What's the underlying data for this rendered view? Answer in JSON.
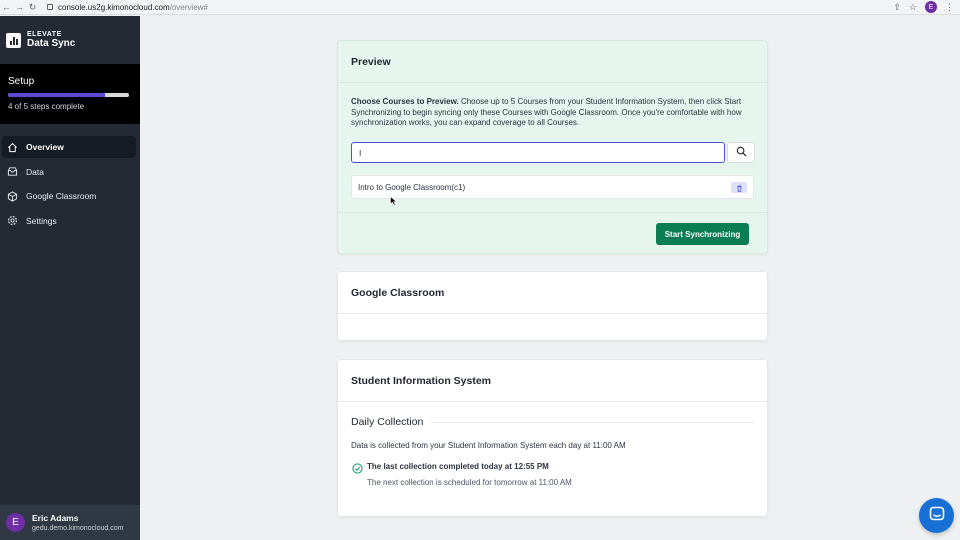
{
  "browser": {
    "url_host": "console.us2g.kimonocloud.com",
    "url_path": "/overview#",
    "profile_initial": "E"
  },
  "sidebar": {
    "brand_top": "ELEVATE",
    "brand_bottom": "Data Sync",
    "setup": {
      "title": "Setup",
      "steps_label": "4 of 5 steps complete",
      "progress_fraction": 0.8
    },
    "items": [
      {
        "label": "Overview",
        "icon": "home-icon",
        "active": true
      },
      {
        "label": "Data",
        "icon": "database-icon",
        "active": false
      },
      {
        "label": "Google Classroom",
        "icon": "cube-icon",
        "active": false
      },
      {
        "label": "Settings",
        "icon": "gear-icon",
        "active": false
      }
    ],
    "user": {
      "initial": "E",
      "name": "Eric Adams",
      "email": "gedu.demo.kimonocloud.com"
    }
  },
  "preview": {
    "title": "Preview",
    "desc_bold": "Choose Courses to Preview.",
    "desc_rest": " Choose up to 5 Courses from your Student Information System, then click Start Synchronizing to begin syncing only these Courses with Google Classroom. Once you're comfortable with how synchronization works, you can expand coverage to all Courses.",
    "search_value": "I",
    "courses": [
      "Intro to Google Classroom(c1)"
    ],
    "sync_button": "Start Synchronizing"
  },
  "google_classroom": {
    "title": "Google Classroom"
  },
  "sis": {
    "title": "Student Information System",
    "daily_title": "Daily Collection",
    "daily_desc": "Data is collected from your Student Information System each day at 11:00 AM",
    "last_status": "The last collection completed today at 12:55 PM",
    "next_status": "The next collection is scheduled for tomorrow at 11:00 AM"
  },
  "colors": {
    "accent": "#4a4fd4",
    "sync_green": "#0b7d54",
    "sidebar_bg": "#232a34",
    "chat_blue": "#1870d5"
  }
}
